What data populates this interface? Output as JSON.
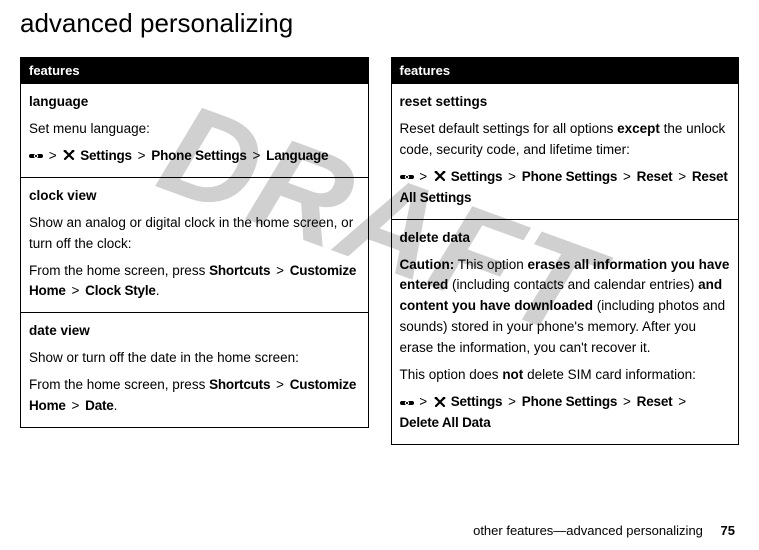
{
  "watermark": "DRAFT",
  "heading": "advanced personalizing",
  "tableHeader": "features",
  "left": {
    "language": {
      "title": "language",
      "desc": "Set menu language:",
      "path": {
        "a": "Settings",
        "b": "Phone Settings",
        "c": "Language"
      }
    },
    "clockView": {
      "title": "clock view",
      "desc": "Show an analog or digital clock in the home screen, or turn off the clock:",
      "lead": "From the home screen, press ",
      "path": {
        "a": "Shortcuts",
        "b": "Customize Home",
        "c": "Clock Style"
      }
    },
    "dateView": {
      "title": "date view",
      "desc": "Show or turn off the date in the home screen:",
      "lead": "From the home screen, press ",
      "path": {
        "a": "Shortcuts",
        "b": "Customize Home",
        "c": "Date"
      }
    }
  },
  "right": {
    "resetSettings": {
      "title": "reset settings",
      "descA": "Reset default settings for all options ",
      "descBold": "except",
      "descB": " the unlock code, security code, and lifetime timer:",
      "path": {
        "a": "Settings",
        "b": "Phone Settings",
        "c": "Reset",
        "d": "Reset All Settings"
      }
    },
    "deleteData": {
      "title": "delete data",
      "cautionLabel": "Caution:",
      "p1a": " This option ",
      "p1b": "erases all information you have entered",
      "p1c": " (including contacts and calendar entries) ",
      "p1d": "and content you have downloaded",
      "p1e": " (including photos and sounds) stored in your phone's memory. After you erase the information, you can't recover it.",
      "p2a": "This option does ",
      "p2b": "not",
      "p2c": " delete SIM card information:",
      "path": {
        "a": "Settings",
        "b": "Phone Settings",
        "c": "Reset",
        "d": "Delete All Data"
      }
    }
  },
  "footer": {
    "text": "other features—advanced personalizing",
    "page": "75"
  },
  "sym": {
    "gt": ">",
    "period": "."
  }
}
